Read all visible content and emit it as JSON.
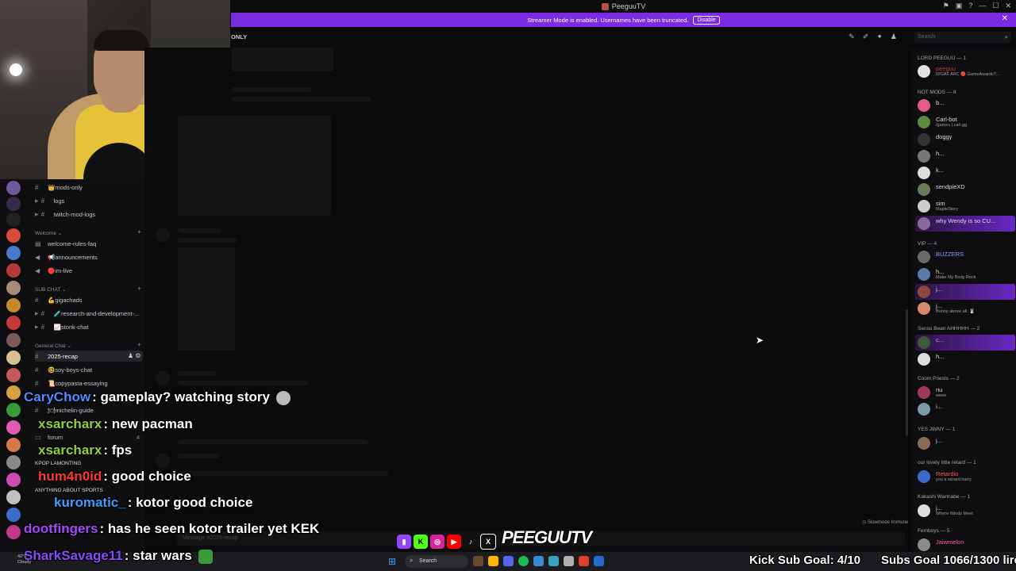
{
  "window": {
    "title": "PeeguuTV"
  },
  "banner": {
    "text": "Streamer Mode is enabled. Usernames have been truncated.",
    "button": "Disable"
  },
  "channel_header": {
    "name": "ONLY"
  },
  "search": {
    "placeholder": "Search"
  },
  "channels": {
    "items_top": [
      {
        "label": "👑mods-only"
      },
      {
        "label": "logs"
      },
      {
        "label": "twitch-mod-logs"
      }
    ],
    "categories": [
      {
        "label": "Welcome",
        "items": [
          "welcome-rules-faq",
          "📢announcements",
          "🔴im-live"
        ]
      },
      {
        "label": "SUB CHAT",
        "items": [
          "💪gigachads",
          "🧪research-and-development-...",
          "📈stonk-chat"
        ]
      },
      {
        "label": "General Chat",
        "items": [
          "2025-recap",
          "🤓soy-boys-chat",
          "📜copypasta-essaying",
          "🍽michelin-guide",
          "forum"
        ]
      }
    ],
    "extra_categories": [
      "KPOP LAMONTING",
      "ANYTHING ABOUT SPORTS"
    ],
    "forum_count": "4",
    "message_placeholder": "Message #2025-recap"
  },
  "members": {
    "groups": [
      {
        "label": "LORD PEEGUU — 1"
      },
      {
        "label": "NOT MODS — 8"
      },
      {
        "label": "VIP — 4"
      },
      {
        "label": "Sensu Bean AHHHHH — 2"
      },
      {
        "label": "Coom Priests — 2"
      },
      {
        "label": "YES JINNY — 1"
      },
      {
        "label": "our lovely little retard — 1"
      },
      {
        "label": "Kakashi Wannabe — 1"
      },
      {
        "label": "Femboys — 5"
      }
    ],
    "list": [
      {
        "name": "peeguu",
        "badge": "POON",
        "status": "IDGAF ARC 🔴 GameAwards?…",
        "color": "#c7333b"
      },
      {
        "name": "b...",
        "badge": "PINK",
        "status": "",
        "color": "#e35d8c"
      },
      {
        "name": "Carl-bot",
        "badge": "APP",
        "status": "/games | carl.gg",
        "color": "#e0e0e0"
      },
      {
        "name": "doggy",
        "badge": "POON",
        "status": "",
        "color": "#e0e0e0"
      },
      {
        "name": "h...",
        "badge": "",
        "status": "",
        "color": "#e0e0e0"
      },
      {
        "name": "k...",
        "badge": "",
        "status": "",
        "color": "#e0e0e0"
      },
      {
        "name": "sendpieXD",
        "badge": "",
        "status": "",
        "color": "#e0e0e0"
      },
      {
        "name": "sim",
        "badge": "",
        "status": "MapleStory",
        "color": "#e0e0e0"
      },
      {
        "name": "why Wendy is so CU...",
        "badge": "",
        "status": "",
        "color": "#d4a0ff"
      },
      {
        "name": "BUZZERS",
        "badge": "BERT",
        "status": "",
        "color": "#8aa0ff"
      },
      {
        "name": "h...",
        "badge": "",
        "status": "Make My Body Rock",
        "color": "#e0e0e0"
      },
      {
        "name": "j...",
        "badge": "POON",
        "status": "",
        "color": "#e0e0e0"
      },
      {
        "name": "j...",
        "badge": "DWCH",
        "status": "Bunny above all. 🐰",
        "color": "#e0e0e0"
      },
      {
        "name": "c...",
        "badge": "",
        "status": "",
        "color": "#b08cff"
      },
      {
        "name": "h...",
        "badge": "KEEK",
        "status": "",
        "color": "#e0e0e0"
      },
      {
        "name": "nu",
        "badge": "",
        "status": "weee",
        "color": "#e0e0e0"
      },
      {
        "name": "i...",
        "badge": "",
        "status": "",
        "color": "#e0e0e0"
      },
      {
        "name": "j...",
        "badge": "",
        "status": "",
        "color": "#e0e0e0"
      },
      {
        "name": "Retardio",
        "badge": "DIVE",
        "status": "you a wizard harry",
        "color": "#ff5a5a"
      },
      {
        "name": "j...",
        "badge": "KAOS",
        "status": "Where Winds Meet",
        "color": "#e0e0e0"
      },
      {
        "name": "Jaiwmelon",
        "badge": "SNIPY",
        "status": "",
        "color": "#ff5fa0"
      }
    ]
  },
  "slowmode": "Slowmode Immune",
  "twitch_chat": [
    {
      "user": "CaryChow",
      "text": ": gameplay? watching story",
      "color": "#4a8cff"
    },
    {
      "user": "xsarcharx",
      "text": ": new pacman",
      "color": "#9acd32"
    },
    {
      "user": "xsarcharx",
      "text": ": fps",
      "color": "#9acd32"
    },
    {
      "user": "hum4n0id",
      "text": ": good choice",
      "color": "#ff3a2a"
    },
    {
      "user": "kuromatic_",
      "text": ": kotor good choice",
      "color": "#3aa0ff"
    },
    {
      "user": "dootfingers",
      "text": ": has he seen kotor trailer yet KEK",
      "color": "#a64aff"
    },
    {
      "user": "SharkSavage11",
      "text": ": star wars",
      "color": "#8a4aff"
    }
  ],
  "overlay": {
    "brand": "PEEGUUTV",
    "kick_goal": "Kick Sub Goal: 4/10",
    "subs_goal": "Subs Goal 1066/1300 lire"
  },
  "taskbar": {
    "search": "Search",
    "weather": "42°F",
    "weather_desc": "Cloudy"
  },
  "colors": {
    "accent": "#7b2be2",
    "background": "#0b0b0d"
  }
}
